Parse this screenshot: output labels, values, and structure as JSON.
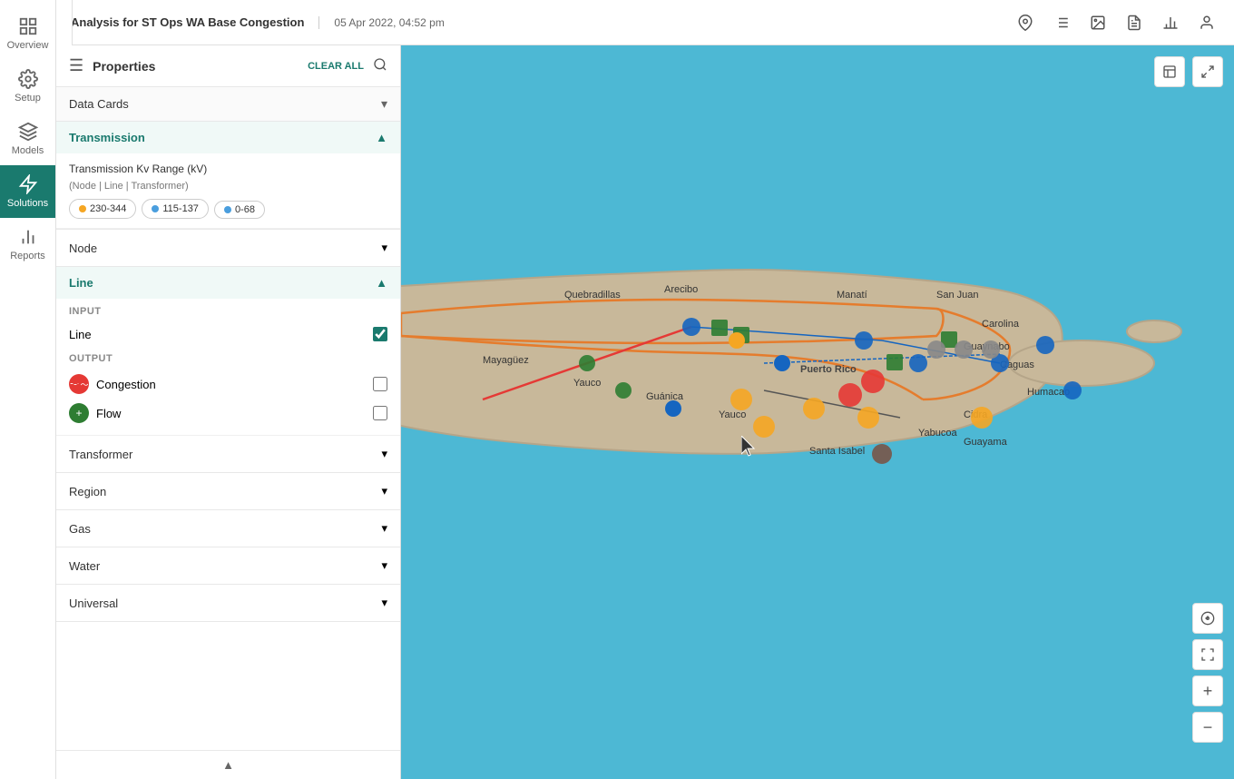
{
  "app": {
    "title": "Analysis for ",
    "title_bold": "ST Ops WA Base Congestion",
    "date": "05 Apr 2022, 04:52 pm"
  },
  "sidebar": {
    "items": [
      {
        "label": "Overview",
        "icon": "grid"
      },
      {
        "label": "Setup",
        "icon": "settings"
      },
      {
        "label": "Models",
        "icon": "layers"
      },
      {
        "label": "Solutions",
        "icon": "flash",
        "active": true
      },
      {
        "label": "Reports",
        "icon": "chart"
      }
    ],
    "solutions_tab": "Solutions ↓"
  },
  "header_icons": [
    "location-icon",
    "list-icon",
    "image-icon",
    "document-icon",
    "chart-icon",
    "person-icon"
  ],
  "panel": {
    "title": "Properties",
    "clear_all": "CLEAR ALL",
    "sections": {
      "data_cards": {
        "label": "Data Cards",
        "expanded": true
      },
      "transmission": {
        "label": "Transmission",
        "expanded": true,
        "kv_range_label": "Transmission Kv Range (kV)",
        "kv_range_sublabel": "(Node | Line | Transformer)",
        "kv_tags": [
          {
            "label": "230-344",
            "color": "#f5a623"
          },
          {
            "label": "115-137",
            "color": "#4a9ede"
          },
          {
            "label": "0-68",
            "color": "#4a9ede"
          }
        ]
      },
      "node": {
        "label": "Node",
        "expanded": false
      },
      "line": {
        "label": "Line",
        "expanded": true,
        "input_label": "INPUT",
        "input_items": [
          {
            "label": "Line",
            "checked": true,
            "icon_color": null
          }
        ],
        "output_label": "OUTPUT",
        "output_items": [
          {
            "label": "Congestion",
            "checked": false,
            "icon_type": "wave",
            "icon_color": "red"
          },
          {
            "label": "Flow",
            "checked": false,
            "icon_type": "plus",
            "icon_color": "green"
          }
        ]
      },
      "transformer": {
        "label": "Transformer",
        "expanded": false
      },
      "region": {
        "label": "Region",
        "expanded": false
      },
      "gas": {
        "label": "Gas",
        "expanded": false
      },
      "water": {
        "label": "Water",
        "expanded": false
      },
      "universal": {
        "label": "Universal",
        "expanded": false
      }
    }
  },
  "map_controls": {
    "top_right": [
      "layers-icon",
      "expand-icon"
    ],
    "bottom_right": [
      "crosshair-icon",
      "fullscreen-icon",
      "zoom-in",
      "zoom-out"
    ]
  },
  "colors": {
    "teal": "#1a7a6e",
    "map_water": "#4db8d4",
    "map_land": "#d4c9a8",
    "orange_line": "#e57c2d"
  }
}
